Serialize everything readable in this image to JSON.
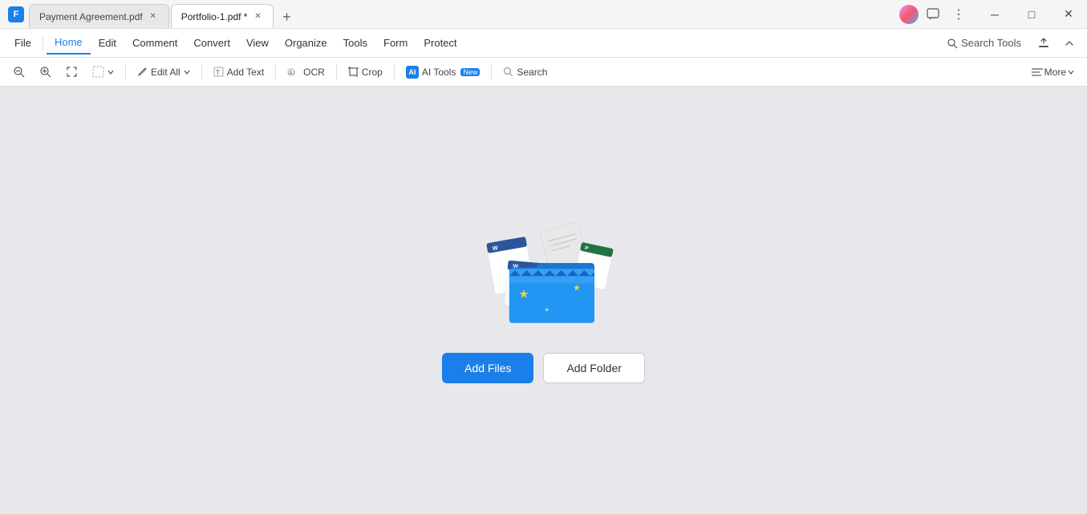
{
  "titlebar": {
    "app_icon_label": "F",
    "tabs": [
      {
        "id": "tab1",
        "label": "Payment Agreement.pdf",
        "active": false
      },
      {
        "id": "tab2",
        "label": "Portfolio-1.pdf *",
        "active": true
      }
    ],
    "new_tab_icon": "+",
    "avatar_alt": "user-avatar",
    "icons": {
      "chat": "💬",
      "more": "⋮",
      "minimize": "─",
      "maximize": "□",
      "close": "✕"
    }
  },
  "menubar": {
    "file_label": "File",
    "items": [
      {
        "id": "home",
        "label": "Home",
        "active": true
      },
      {
        "id": "edit",
        "label": "Edit",
        "active": false
      },
      {
        "id": "comment",
        "label": "Comment",
        "active": false
      },
      {
        "id": "convert",
        "label": "Convert",
        "active": false
      },
      {
        "id": "view",
        "label": "View",
        "active": false
      },
      {
        "id": "organize",
        "label": "Organize",
        "active": false
      },
      {
        "id": "tools",
        "label": "Tools",
        "active": false
      },
      {
        "id": "form",
        "label": "Form",
        "active": false
      },
      {
        "id": "protect",
        "label": "Protect",
        "active": false
      }
    ],
    "search_tools_label": "Search Tools",
    "upload_icon": "⬆",
    "chevron_icon": "∧"
  },
  "toolbar": {
    "items": [
      {
        "id": "zoom-out",
        "icon": "🔍−",
        "label": "",
        "type": "icon"
      },
      {
        "id": "zoom-in",
        "icon": "🔍+",
        "label": "",
        "type": "icon"
      },
      {
        "id": "marquee",
        "icon": "✦",
        "label": "",
        "type": "icon"
      },
      {
        "id": "select",
        "icon": "□",
        "label": "",
        "type": "icon"
      },
      {
        "id": "edit-all",
        "label": "Edit All",
        "has_dropdown": true
      },
      {
        "id": "add-text",
        "label": "Add Text",
        "icon": "T"
      },
      {
        "id": "ocr",
        "label": "OCR",
        "icon": "A̲"
      },
      {
        "id": "crop",
        "label": "Crop",
        "icon": "⊡"
      },
      {
        "id": "ai-tools",
        "label": "AI Tools",
        "icon": "AI",
        "badge": "New"
      },
      {
        "id": "search",
        "label": "Search",
        "icon": "🔍"
      }
    ],
    "more_label": "More",
    "more_icon": "≡"
  },
  "main": {
    "illustration_alt": "folder-with-documents",
    "add_files_label": "Add Files",
    "add_folder_label": "Add Folder"
  },
  "colors": {
    "accent": "#1a7fe8",
    "folder_blue": "#2196f3",
    "background": "#e8e8ec"
  }
}
